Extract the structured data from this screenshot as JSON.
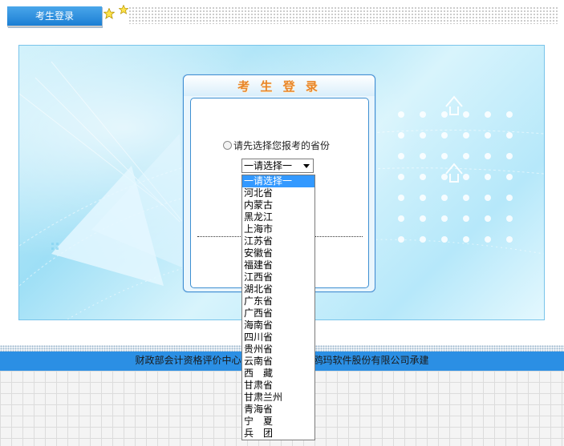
{
  "header": {
    "tab_label": "考生登录"
  },
  "login": {
    "title": "考 生 登 录",
    "prompt": "请先选择您报考的省份"
  },
  "province_select": {
    "selected": "一请选择一",
    "options": [
      "一请选择一",
      "河北省",
      "内蒙古",
      "黑龙江",
      "上海市",
      "江苏省",
      "安徽省",
      "福建省",
      "江西省",
      "湖北省",
      "广东省",
      "广西省",
      "海南省",
      "四川省",
      "贵州省",
      "云南省",
      "西　藏",
      "甘肃省",
      "甘肃兰州",
      "青海省",
      "宁　夏",
      "兵　团"
    ]
  },
  "footer": {
    "left_text": "财政部会计资格评价中心",
    "right_text": "鸥玛软件股份有限公司承建"
  },
  "colors": {
    "accent": "#2b8fe4",
    "title": "#e8862a",
    "selection": "#3399ff"
  }
}
